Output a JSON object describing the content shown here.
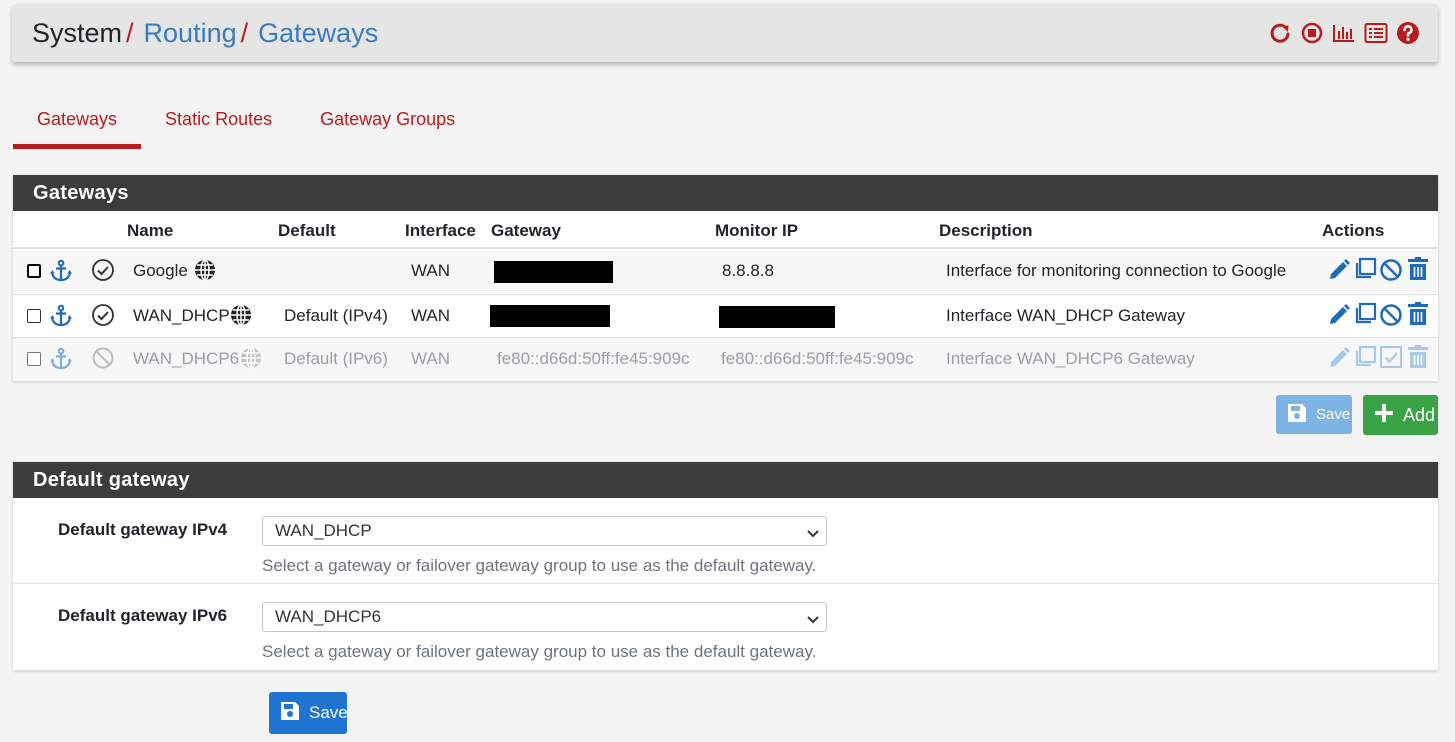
{
  "breadcrumb": {
    "root": "System",
    "separator": "/",
    "level1": "Routing",
    "level2": "Gateways"
  },
  "header_icons": [
    "reload-icon",
    "stop-icon",
    "bar-chart-icon",
    "list-icon",
    "help-icon"
  ],
  "tabs": [
    {
      "label": "Gateways",
      "active": true
    },
    {
      "label": "Static Routes",
      "active": false
    },
    {
      "label": "Gateway Groups",
      "active": false
    }
  ],
  "gateways_panel": {
    "title": "Gateways",
    "columns": {
      "name": "Name",
      "default": "Default",
      "interface": "Interface",
      "gateway": "Gateway",
      "monitor": "Monitor IP",
      "description": "Description",
      "actions": "Actions"
    },
    "rows": [
      {
        "name": "Google",
        "default": "",
        "interface": "WAN",
        "gateway": "",
        "monitor": "8.8.8.8",
        "description": "Interface for monitoring connection to Google",
        "enabled": true
      },
      {
        "name": "WAN_DHCP",
        "default": "Default (IPv4)",
        "interface": "WAN",
        "gateway": "",
        "monitor": "",
        "description": "Interface WAN_DHCP Gateway",
        "enabled": true
      },
      {
        "name": "WAN_DHCP6",
        "default": "Default (IPv6)",
        "interface": "WAN",
        "gateway": "fe80::d66d:50ff:fe45:909c",
        "monitor": "fe80::d66d:50ff:fe45:909c",
        "description": "Interface WAN_DHCP6 Gateway",
        "enabled": false
      }
    ],
    "save_label": "Save",
    "add_label": "Add"
  },
  "default_gateway_panel": {
    "title": "Default gateway",
    "ipv4": {
      "label": "Default gateway IPv4",
      "value": "WAN_DHCP",
      "help": "Select a gateway or failover gateway group to use as the default gateway."
    },
    "ipv6": {
      "label": "Default gateway IPv6",
      "value": "WAN_DHCP6",
      "help": "Select a gateway or failover gateway group to use as the default gateway."
    },
    "save_label": "Save"
  },
  "colors": {
    "accent_red": "#b71c1c",
    "link_blue": "#3a7dbf",
    "panel_header": "#3c3c3c",
    "action_blue": "#1e6bb8",
    "add_green": "#3aa346",
    "save_blue": "#1e74d0",
    "save_disabled": "#7eb3e5"
  }
}
